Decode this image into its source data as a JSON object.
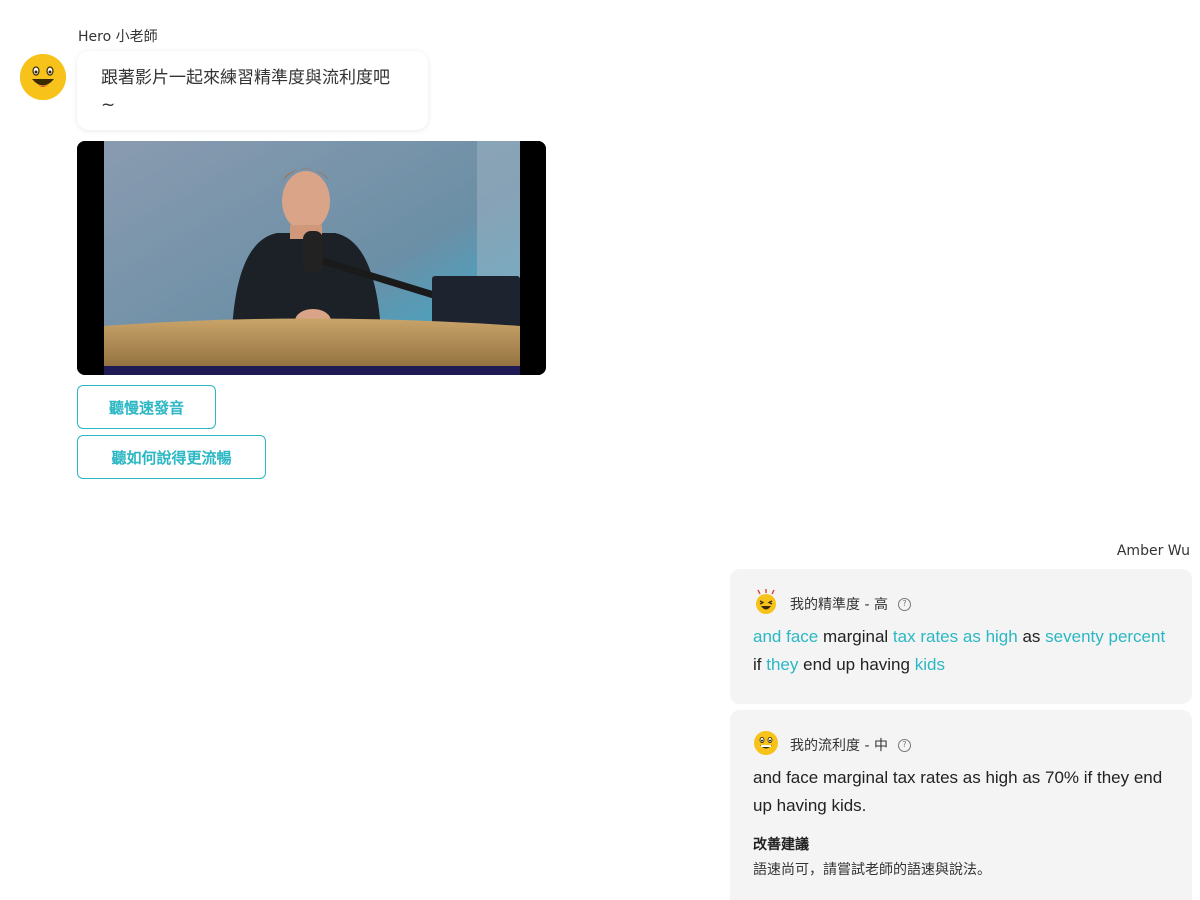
{
  "tutor": {
    "name": "Hero 小老師",
    "avatar_icon": "smiley-face-icon",
    "message": "跟著影片一起來練習精準度與流利度吧~",
    "video_icon": "video-player",
    "buttons": [
      "聽慢速發音",
      "聽如何說得更流暢"
    ]
  },
  "user": {
    "name": "Amber Wu",
    "accuracy": {
      "icon": "laughing-face-icon",
      "label": "我的精準度 - 高",
      "help_icon": "help-circle-icon",
      "words": [
        {
          "t": "and",
          "ok": true
        },
        {
          "t": "face",
          "ok": true
        },
        {
          "t": "marginal",
          "ok": false
        },
        {
          "t": "tax",
          "ok": true
        },
        {
          "t": "rates",
          "ok": true
        },
        {
          "t": "as",
          "ok": true
        },
        {
          "t": "high",
          "ok": true
        },
        {
          "t": "as",
          "ok": false
        },
        {
          "t": "seventy",
          "ok": true
        },
        {
          "t": "percent",
          "ok": true
        },
        {
          "t": "if",
          "ok": false
        },
        {
          "t": "they",
          "ok": true
        },
        {
          "t": "end",
          "ok": false
        },
        {
          "t": "up",
          "ok": false
        },
        {
          "t": "having",
          "ok": false
        },
        {
          "t": "kids",
          "ok": true
        }
      ]
    },
    "fluency": {
      "icon": "grinning-face-icon",
      "label": "我的流利度 - 中",
      "help_icon": "help-circle-icon",
      "transcript": "and face marginal tax rates as high as 70% if they end up having kids.",
      "suggestion_title": "改善建議",
      "suggestion_text": "語速尚可，請嘗試老師的語速與說法。"
    }
  },
  "colors": {
    "accent": "#2bb7c4",
    "avatar": "#f7c21a",
    "card_bg": "#f4f4f4"
  }
}
